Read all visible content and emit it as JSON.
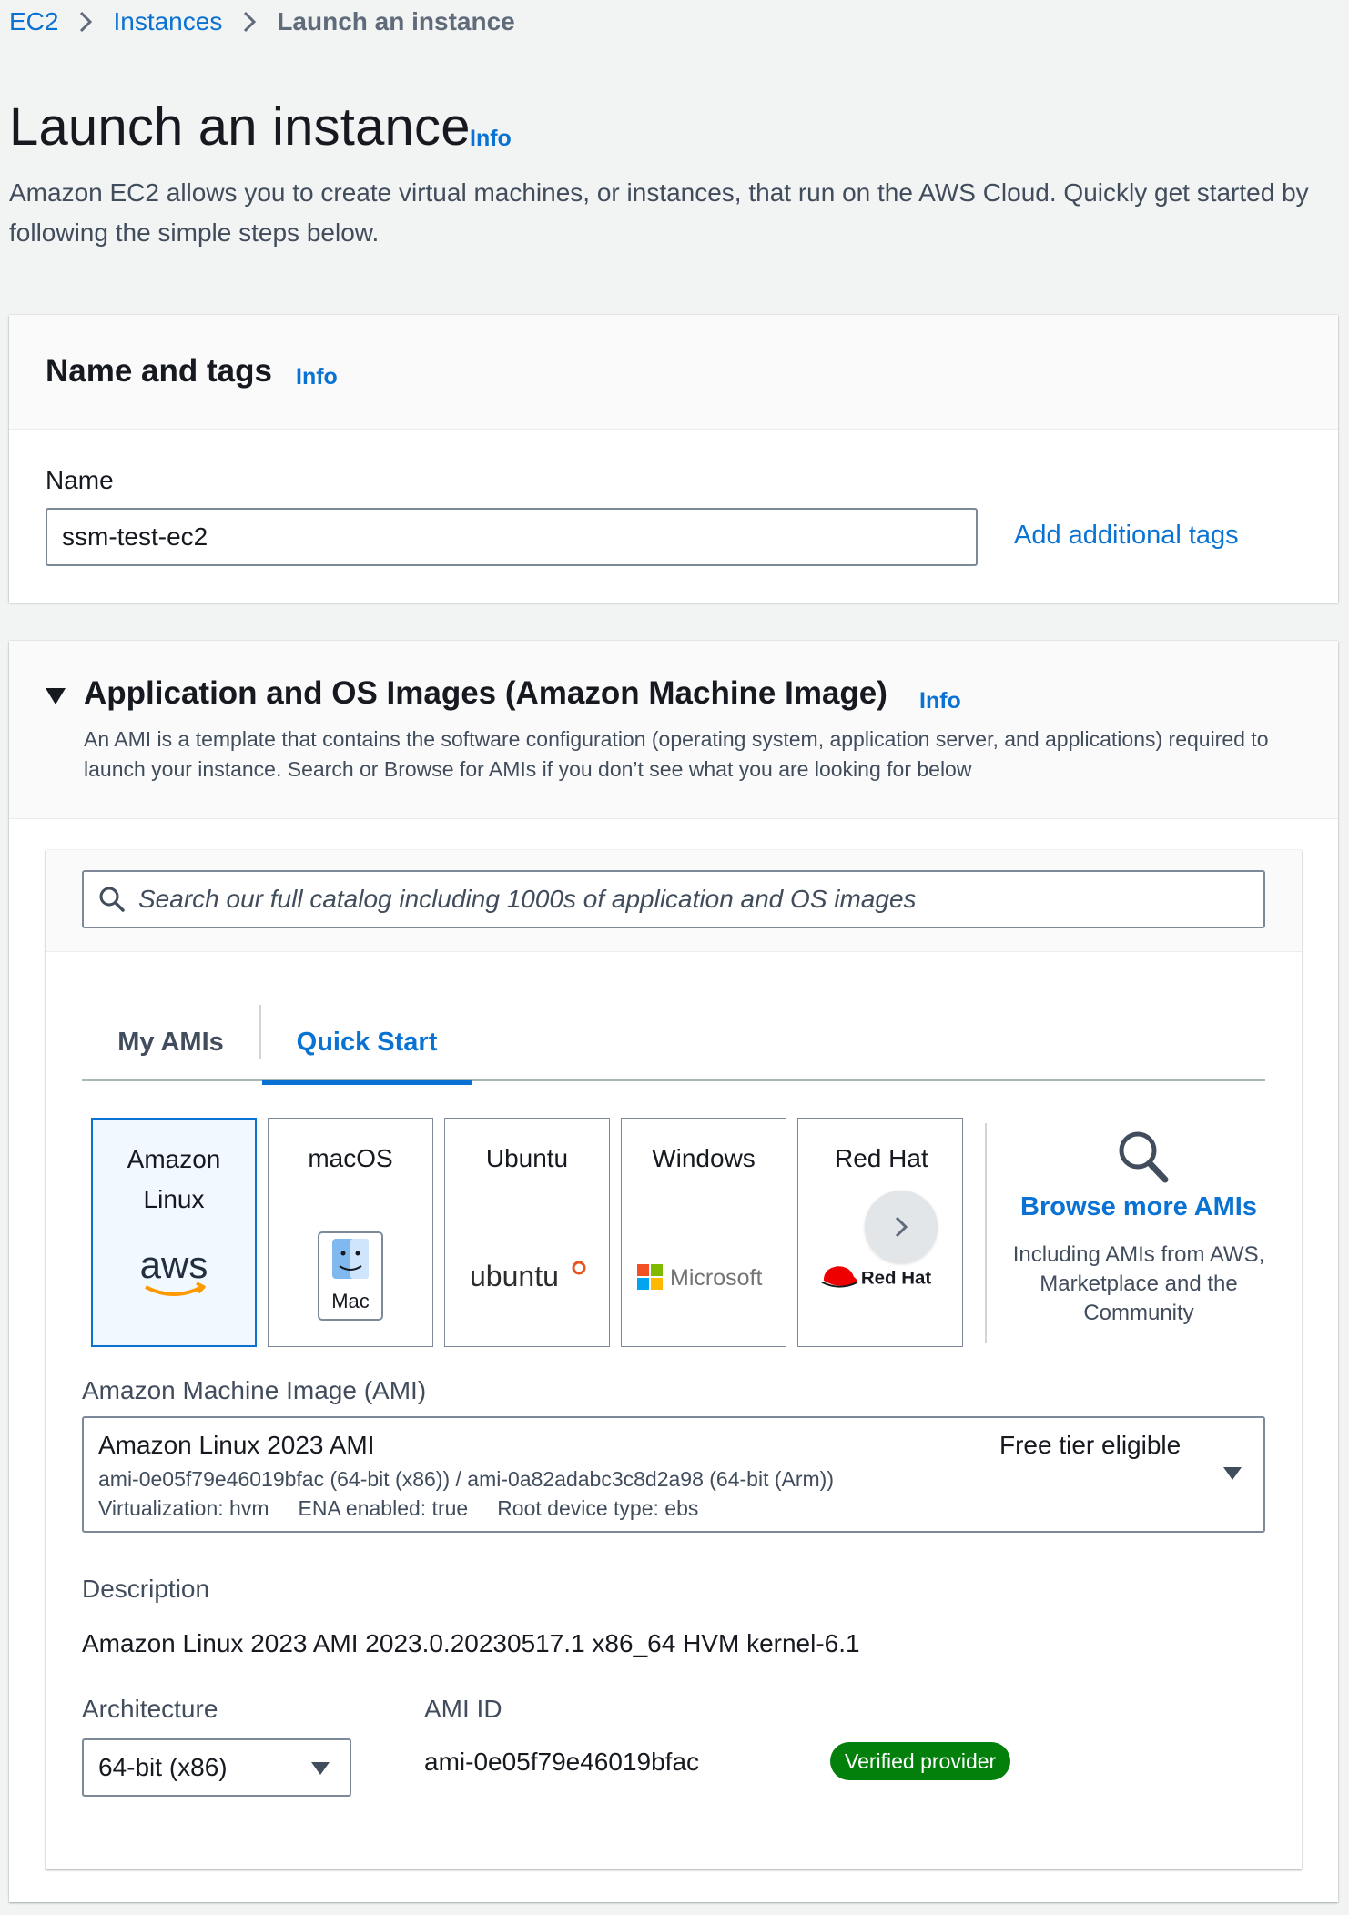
{
  "breadcrumb": {
    "items": [
      "EC2",
      "Instances"
    ],
    "current": "Launch an instance"
  },
  "header": {
    "title": "Launch an instance",
    "info": "Info",
    "description": "Amazon EC2 allows you to create virtual machines, or instances, that run on the AWS Cloud. Quickly get started by following the simple steps below."
  },
  "name_tags": {
    "title": "Name and tags",
    "info": "Info",
    "name_label": "Name",
    "name_value": "ssm-test-ec2",
    "add_tags": "Add additional tags"
  },
  "ami": {
    "title": "Application and OS Images (Amazon Machine Image)",
    "info": "Info",
    "description": "An AMI is a template that contains the software configuration (operating system, application server, and applications) required to launch your instance. Search or Browse for AMIs if you don’t see what you are looking for below",
    "search_placeholder": "Search our full catalog including 1000s of application and OS images",
    "tabs": [
      "My AMIs",
      "Quick Start"
    ],
    "active_tab": "Quick Start",
    "tiles": [
      {
        "label": "Amazon Linux",
        "logo": "aws",
        "selected": true
      },
      {
        "label": "macOS",
        "logo": "Mac",
        "selected": false
      },
      {
        "label": "Ubuntu",
        "logo": "ubuntu",
        "selected": false
      },
      {
        "label": "Windows",
        "logo": "Microsoft",
        "selected": false
      },
      {
        "label": "Red Hat",
        "logo": "Red Hat",
        "selected": false
      }
    ],
    "browse_more": {
      "title": "Browse more AMIs",
      "subtitle": "Including AMIs from AWS, Marketplace and the Community"
    },
    "select_label": "Amazon Machine Image (AMI)",
    "selected_ami": {
      "name": "Amazon Linux 2023 AMI",
      "badge": "Free tier eligible",
      "ids": "ami-0e05f79e46019bfac (64-bit (x86)) / ami-0a82adabc3c8d2a98 (64-bit (Arm))",
      "virtualization": "Virtualization: hvm",
      "ena": "ENA enabled: true",
      "root_device": "Root device type: ebs"
    },
    "description_label": "Description",
    "description_value": "Amazon Linux 2023 AMI 2023.0.20230517.1 x86_64 HVM kernel-6.1",
    "architecture_label": "Architecture",
    "architecture_value": "64-bit (x86)",
    "ami_id_label": "AMI ID",
    "ami_id_value": "ami-0e05f79e46019bfac",
    "verified_badge": "Verified provider"
  },
  "colors": {
    "link": "#0972d3",
    "badge_green": "#037f0c",
    "background": "#f2f3f3"
  }
}
